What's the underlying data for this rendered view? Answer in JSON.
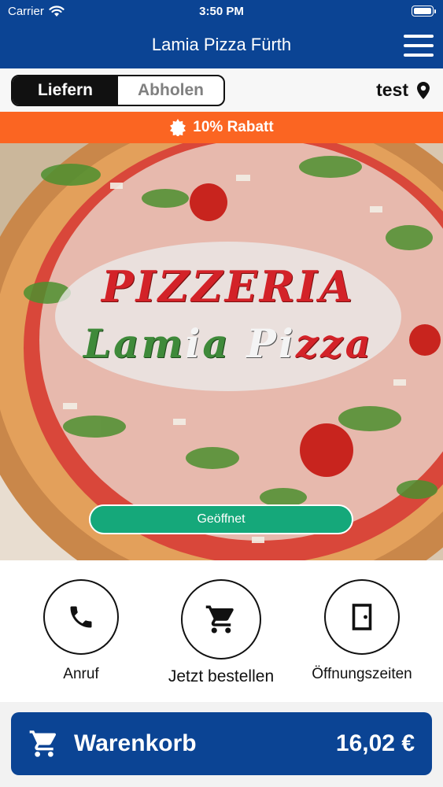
{
  "status_bar": {
    "carrier": "Carrier",
    "time": "3:50 PM"
  },
  "header": {
    "title": "Lamia Pizza Fürth"
  },
  "mode_toggle": {
    "options": [
      "Liefern",
      "Abholen"
    ],
    "selected": "Liefern"
  },
  "location": {
    "label": "test"
  },
  "discount_banner": {
    "text": "10% Rabatt"
  },
  "hero": {
    "logo_line1": "PIZZERIA",
    "logo_line2": "Lamia Pizza",
    "status": "Geöffnet"
  },
  "actions": [
    {
      "label": "Anruf",
      "icon": "phone-icon"
    },
    {
      "label": "Jetzt bestellen",
      "icon": "cart-icon"
    },
    {
      "label": "Öffnungszeiten",
      "icon": "door-icon"
    }
  ],
  "cart": {
    "label": "Warenkorb",
    "total": "16,02 €"
  },
  "colors": {
    "primary": "#0b4494",
    "discount": "#fb6522",
    "open_status": "#15a87a"
  }
}
